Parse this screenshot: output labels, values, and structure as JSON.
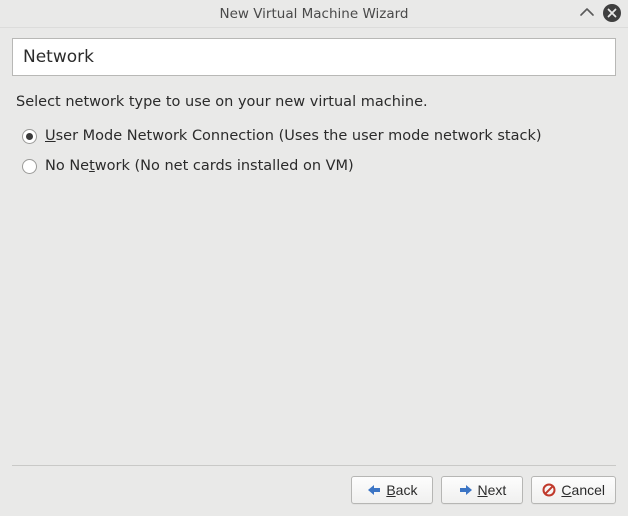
{
  "window": {
    "title": "New Virtual Machine Wizard"
  },
  "heading": "Network",
  "instruction": "Select network type to use on your new virtual machine.",
  "options": {
    "user_mode": {
      "before": "",
      "mnemonic": "U",
      "after": "ser Mode Network Connection (Uses the user mode network stack)",
      "checked": true
    },
    "no_network": {
      "before": "No Ne",
      "mnemonic": "t",
      "after": "work (No net cards installed on VM)",
      "checked": false
    }
  },
  "buttons": {
    "back": {
      "before": "",
      "mnemonic": "B",
      "after": "ack"
    },
    "next": {
      "before": "",
      "mnemonic": "N",
      "after": "ext"
    },
    "cancel": {
      "before": "",
      "mnemonic": "C",
      "after": "ancel"
    }
  }
}
